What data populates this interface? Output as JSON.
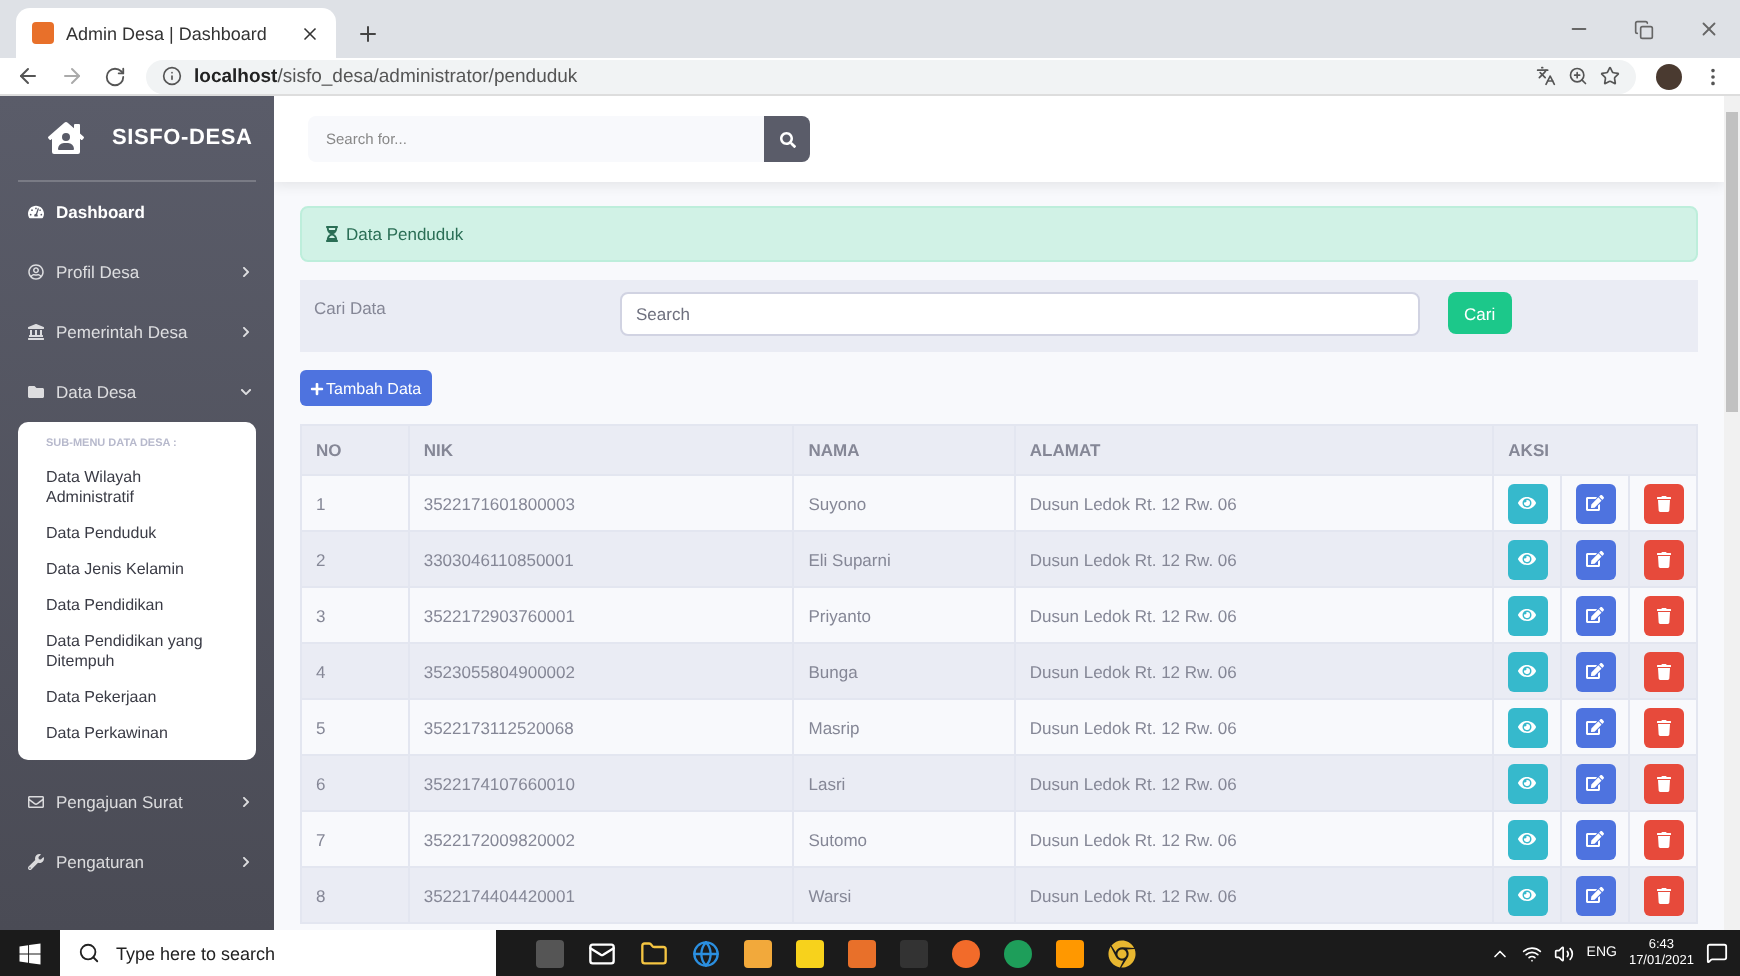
{
  "browser": {
    "tab_title": "Admin Desa | Dashboard",
    "url": "**localhost**/sisfo_desa/administrator/penduduk"
  },
  "sidebar": {
    "brand": "SISFO-DESA",
    "items": [
      {
        "label": "Dashboard",
        "kind": "link",
        "selected": true
      },
      {
        "label": "Profil Desa",
        "kind": "menu",
        "selected": false,
        "expanded": false
      },
      {
        "label": "Pemerintah Desa",
        "kind": "menu",
        "selected": false,
        "expanded": false
      },
      {
        "label": "Data Desa",
        "kind": "menu",
        "selected": false,
        "expanded": true,
        "submenu": {
          "heading": "SUB-MENU DATA DESA :",
          "items": [
            "Data Wilayah Administratif",
            "Data Penduduk",
            "Data Jenis Kelamin",
            "Data Pendidikan",
            "Data Pendidikan yang Ditempuh",
            "Data Pekerjaan",
            "Data Perkawinan"
          ]
        }
      },
      {
        "label": "Pengajuan Surat",
        "kind": "menu",
        "selected": false,
        "expanded": false
      },
      {
        "label": "Pengaturan",
        "kind": "menu",
        "selected": false,
        "expanded": false
      }
    ]
  },
  "topbar": {
    "search_placeholder": "Search for..."
  },
  "alert": {
    "title": "Data Penduduk"
  },
  "search_panel": {
    "label": "Cari Data",
    "placeholder": "Search",
    "button": "Cari"
  },
  "add_button": "Tambah Data",
  "table": {
    "columns": [
      "NO",
      "NIK",
      "NAMA",
      "ALAMAT",
      "AKSI"
    ],
    "rows": [
      {
        "no": "1",
        "nik": "3522171601800003",
        "nama": "Suyono",
        "alamat": "Dusun Ledok Rt. 12 Rw. 06"
      },
      {
        "no": "2",
        "nik": "3303046110850001",
        "nama": "Eli Suparni",
        "alamat": "Dusun Ledok Rt. 12 Rw. 06"
      },
      {
        "no": "3",
        "nik": "3522172903760001",
        "nama": "Priyanto",
        "alamat": "Dusun Ledok Rt. 12 Rw. 06"
      },
      {
        "no": "4",
        "nik": "3523055804900002",
        "nama": "Bunga",
        "alamat": "Dusun Ledok Rt. 12 Rw. 06"
      },
      {
        "no": "5",
        "nik": "3522173112520068",
        "nama": "Masrip",
        "alamat": "Dusun Ledok Rt. 12 Rw. 06"
      },
      {
        "no": "6",
        "nik": "3522174107660010",
        "nama": "Lasri",
        "alamat": "Dusun Ledok Rt. 12 Rw. 06"
      },
      {
        "no": "7",
        "nik": "3522172009820002",
        "nama": "Sutomo",
        "alamat": "Dusun Ledok Rt. 12 Rw. 06"
      },
      {
        "no": "8",
        "nik": "3522174404420001",
        "nama": "Warsi",
        "alamat": "Dusun Ledok Rt. 12 Rw. 06"
      }
    ]
  },
  "taskbar": {
    "search_placeholder": "Type here to search",
    "language": "ENG",
    "time": "6:43",
    "date": "17/01/2021"
  }
}
